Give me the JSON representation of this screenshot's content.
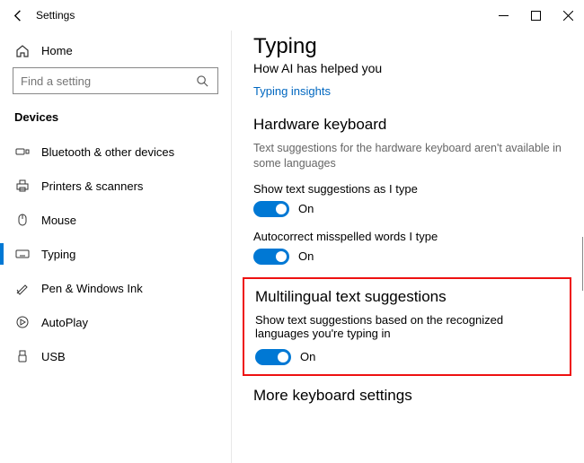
{
  "window": {
    "title": "Settings"
  },
  "sidebar": {
    "home": "Home",
    "search_placeholder": "Find a setting",
    "category": "Devices",
    "items": [
      {
        "label": "Bluetooth & other devices"
      },
      {
        "label": "Printers & scanners"
      },
      {
        "label": "Mouse"
      },
      {
        "label": "Typing"
      },
      {
        "label": "Pen & Windows Ink"
      },
      {
        "label": "AutoPlay"
      },
      {
        "label": "USB"
      }
    ]
  },
  "main": {
    "heading": "Typing",
    "subheading": "How AI has helped you",
    "insights_link": "Typing insights",
    "hw_section": {
      "title": "Hardware keyboard",
      "note": "Text suggestions for the hardware keyboard aren't available in some languages",
      "show_suggestions": {
        "label": "Show text suggestions as I type",
        "state": "On"
      },
      "autocorrect": {
        "label": "Autocorrect misspelled words I type",
        "state": "On"
      }
    },
    "multi_section": {
      "title": "Multilingual text suggestions",
      "desc": "Show text suggestions based on the recognized languages you're typing in",
      "toggle": {
        "state": "On"
      }
    },
    "more_section": {
      "title": "More keyboard settings"
    }
  }
}
